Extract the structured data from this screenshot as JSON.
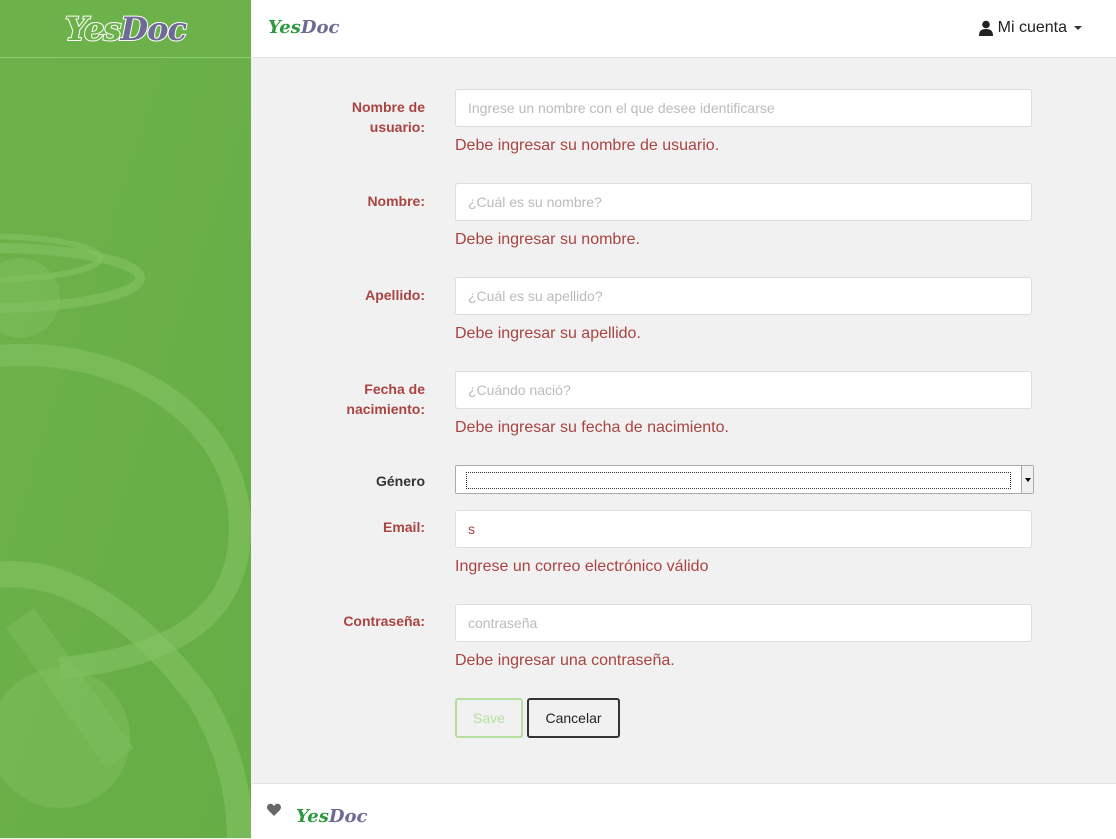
{
  "sidebar": {
    "logo_yes": "Yes",
    "logo_doc": "Doc"
  },
  "topbar": {
    "brand_yes": "Yes",
    "brand_doc": "Doc",
    "account_label": "Mi cuenta"
  },
  "form": {
    "username": {
      "label": "Nombre de usuario:",
      "placeholder": "Ingrese un nombre con el que desee identificarse",
      "value": "",
      "error": "Debe ingresar su nombre de usuario."
    },
    "first_name": {
      "label": "Nombre:",
      "placeholder": "¿Cuál es su nombre?",
      "value": "",
      "error": "Debe ingresar su nombre."
    },
    "last_name": {
      "label": "Apellido:",
      "placeholder": "¿Cuál es su apellido?",
      "value": "",
      "error": "Debe ingresar su apellido."
    },
    "birthdate": {
      "label": "Fecha de nacimiento:",
      "placeholder": "¿Cuándo nació?",
      "value": "",
      "error": "Debe ingresar su fecha de nacimiento."
    },
    "gender": {
      "label": "Género",
      "selected": ""
    },
    "email": {
      "label": "Email:",
      "placeholder": "",
      "value": "s",
      "error": "Ingrese un correo electrónico válido"
    },
    "password": {
      "label": "Contraseña:",
      "placeholder": "contraseña",
      "value": "",
      "error": "Debe ingresar una contraseña."
    },
    "save_label": "Save",
    "cancel_label": "Cancelar"
  },
  "footer": {
    "brand_yes": "Yes",
    "brand_doc": "Doc"
  },
  "colors": {
    "sidebar": "#6db14a",
    "error": "#a94442",
    "brand_green": "#2d9a3e",
    "brand_purple": "#6e6a96"
  },
  "icons": {
    "account": "user-icon",
    "footer": "heart-icon"
  }
}
